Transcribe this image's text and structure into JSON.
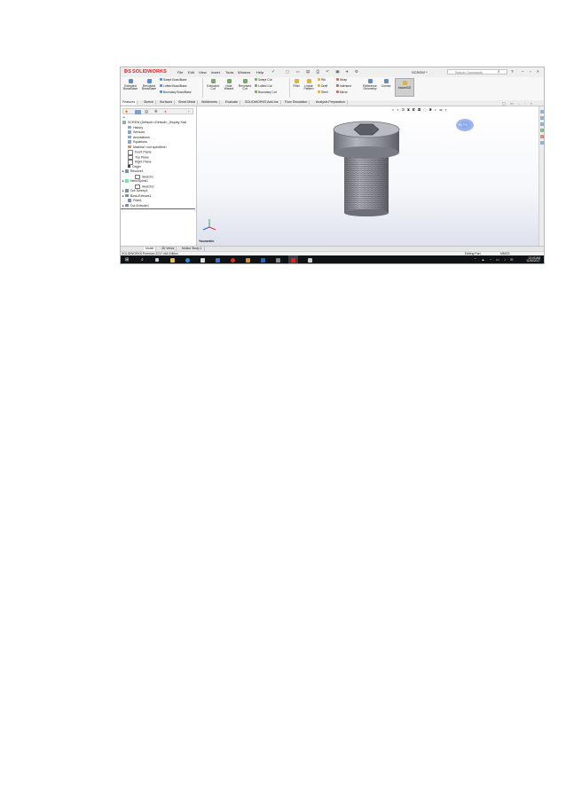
{
  "app": {
    "name": "SOLIDWORKS",
    "menu": [
      "File",
      "Edit",
      "View",
      "Insert",
      "Tools",
      "Window",
      "Help"
    ],
    "document_title": "SCREW *",
    "search_placeholder": "Search Commands"
  },
  "ribbon": {
    "extruded_boss": "Extruded Boss/Base",
    "revolved_boss": "Revolved Boss/Base",
    "swept_boss": "Swept Boss/Base",
    "lofted_boss": "Lofted Boss/Base",
    "boundary_boss": "Boundary Boss/Base",
    "extruded_cut": "Extruded Cut",
    "hole_wizard": "Hole Wizard",
    "revolved_cut": "Revolved Cut",
    "swept_cut": "Swept Cut",
    "lofted_cut": "Lofted Cut",
    "boundary_cut": "Boundary Cut",
    "fillet": "Fillet",
    "linear_pattern": "Linear Pattern",
    "rib": "Rib",
    "draft": "Draft",
    "shell": "Shell",
    "wrap": "Wrap",
    "intersect": "Intersect",
    "mirror": "Mirror",
    "reference_geometry": "Reference Geometry",
    "curves": "Curves",
    "instant3d": "Instant3D"
  },
  "tabs": [
    "Features",
    "Sketch",
    "Surfaces",
    "Sheet Metal",
    "Weldments",
    "Evaluate",
    "SOLIDWORKS Add-Ins",
    "Flow Simulation",
    "Analysis Preparation"
  ],
  "feature_tree": {
    "root": "SCREW (Default<<Default>_Display Stat",
    "items": [
      "History",
      "Sensors",
      "Annotations",
      "Equations",
      "Material <not specified>",
      "Front Plane",
      "Top Plane",
      "Right Plane",
      "Origin",
      "Revolve1",
      "Sketch1",
      "Helix/Spiral1",
      "Sketch3",
      "Cut-Sweep1",
      "Boss-Extrude1",
      "Fillet1",
      "Cut-Extrude1"
    ]
  },
  "graphics": {
    "view_label": "*Isometric",
    "badge": "54.7%"
  },
  "bottom_tabs": [
    "Model",
    "3D Views",
    "Motion Study 1"
  ],
  "status": {
    "edition": "SOLIDWORKS Premium 2017 x64 Edition",
    "mode": "Editing Part",
    "units": "MMGS"
  },
  "taskbar": {
    "time": "12:03 AM",
    "date": "11/30/2017"
  },
  "colors": {
    "screw_body": "#9a9ca4",
    "taskbar": "#101316",
    "brand_red": "#d22222"
  }
}
